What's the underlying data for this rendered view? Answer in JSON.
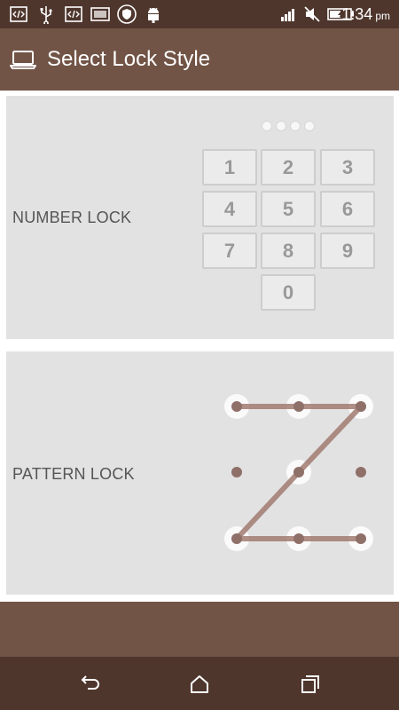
{
  "status_bar": {
    "time": "1:34",
    "ampm": "pm",
    "left_icons": [
      "code-icon",
      "usb-icon",
      "code-icon",
      "screenshot-icon",
      "shield-icon",
      "android-icon"
    ],
    "right_icons": [
      "signal-icon",
      "mute-icon",
      "battery-charging-icon"
    ]
  },
  "app_bar": {
    "icon": "laptop-icon",
    "title": "Select Lock Style"
  },
  "number_lock": {
    "label": "NUMBER LOCK",
    "keys": [
      "1",
      "2",
      "3",
      "4",
      "5",
      "6",
      "7",
      "8",
      "9",
      "0"
    ],
    "pin_dots": 4
  },
  "pattern_lock": {
    "label": "PATTERN LOCK",
    "pattern": "Z"
  },
  "nav_bar": {
    "buttons": [
      "back-icon",
      "home-icon",
      "recents-icon"
    ]
  },
  "colors": {
    "status_bar": "#4e362d",
    "app_bar": "#715446",
    "card": "#e3e2e3",
    "pattern_line": "#a07a70",
    "pattern_dot": "#8f7069"
  }
}
